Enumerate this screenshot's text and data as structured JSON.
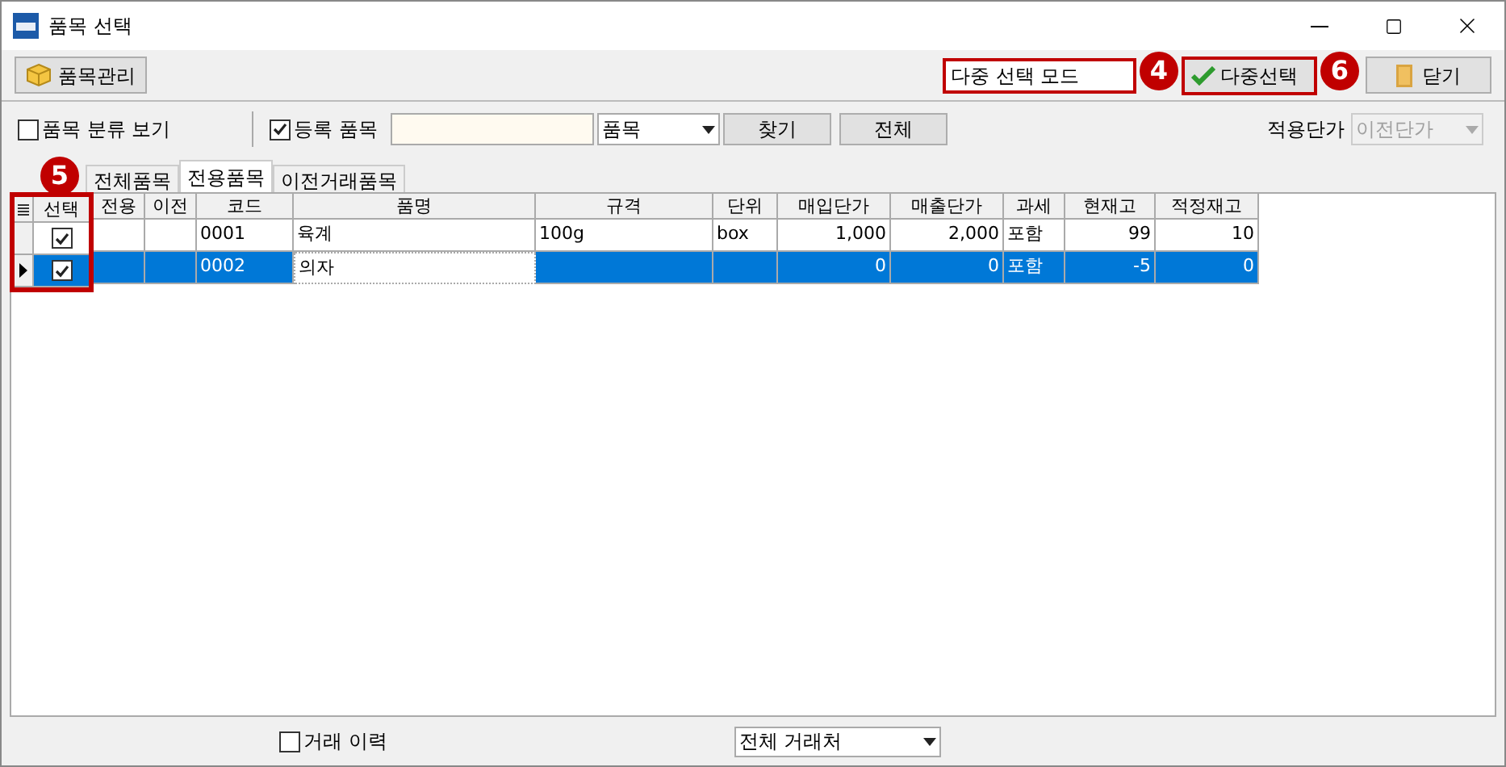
{
  "window": {
    "title": "품목 선택"
  },
  "toolbar": {
    "manage_button": "품목관리",
    "mode_select": {
      "value": "다중 선택 모드",
      "badge": "4"
    },
    "multi_select_button": {
      "label": "다중선택",
      "badge": "6"
    },
    "close_button": "닫기"
  },
  "filters": {
    "category_view": {
      "label": "품목 분류 보기",
      "checked": false
    },
    "registered": {
      "label": "등록 품목",
      "checked": true
    },
    "field_select": "품목",
    "find_button": "찾기",
    "all_button": "전체",
    "price_label": "적용단가",
    "price_select": {
      "value": "이전단가",
      "disabled": true
    }
  },
  "tabs": [
    {
      "label": "전체품목",
      "selected": false
    },
    {
      "label": "전용품목",
      "selected": true
    },
    {
      "label": "이전거래품목",
      "selected": false
    }
  ],
  "table": {
    "check_badge": "5",
    "columns": [
      "선택",
      "전용",
      "이전",
      "코드",
      "품명",
      "규격",
      "단위",
      "매입단가",
      "매출단가",
      "과세",
      "현재고",
      "적정재고"
    ],
    "rows": [
      {
        "checked": true,
        "selected": false,
        "current": false,
        "code": "0001",
        "name": "육계",
        "spec": "100g",
        "unit": "box",
        "buy_price": "1,000",
        "sell_price": "2,000",
        "tax": "포함",
        "stock": "99",
        "proper_stock": "10"
      },
      {
        "checked": true,
        "selected": true,
        "current": true,
        "code": "0002",
        "name": "의자",
        "buy_price": "0",
        "sell_price": "0",
        "tax": "포함",
        "stock": "-5",
        "proper_stock": "0"
      }
    ]
  },
  "bottom": {
    "history": {
      "label": "거래 이력",
      "checked": false
    },
    "partner_select": "전체 거래처"
  }
}
